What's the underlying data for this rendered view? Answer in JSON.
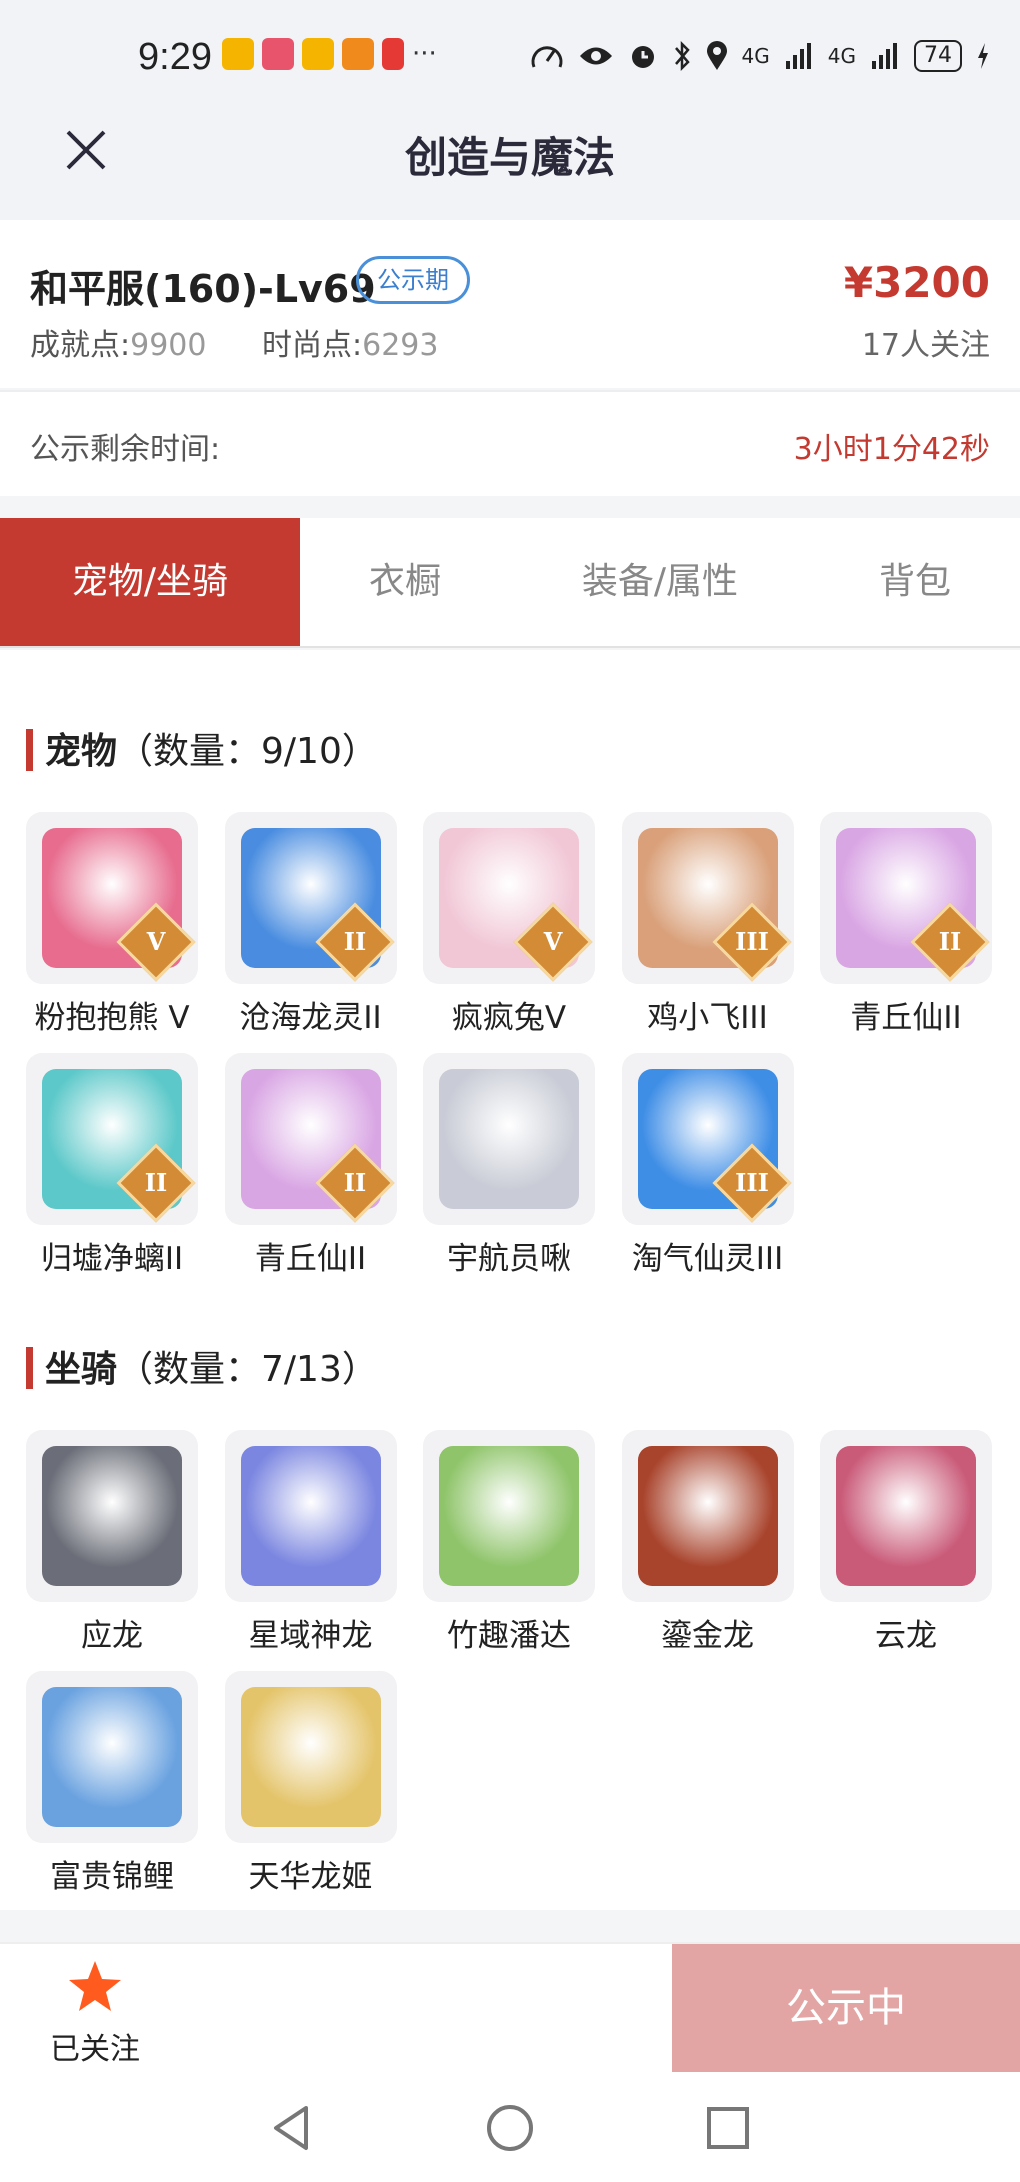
{
  "status_bar": {
    "time": "9:29",
    "network": "4G",
    "battery": "74"
  },
  "nav": {
    "title": "创造与魔法",
    "close_icon": "close-icon"
  },
  "listing": {
    "title": "和平服(160)-Lv69",
    "badge": "公示期",
    "price": "¥3200",
    "achievement_label": "成就点:",
    "achievement_value": "9900",
    "fashion_label": "时尚点:",
    "fashion_value": "6293",
    "followers": "17人关注"
  },
  "timer": {
    "label": "公示剩余时间:",
    "value": "3小时1分42秒"
  },
  "tabs": [
    {
      "label": "宠物/坐骑",
      "active": true
    },
    {
      "label": "衣橱",
      "active": false
    },
    {
      "label": "装备/属性",
      "active": false
    },
    {
      "label": "背包",
      "active": false
    }
  ],
  "pets": {
    "title": "宠物",
    "count": "（数量：9/10）",
    "items": [
      {
        "name": "粉抱抱熊 V",
        "level": "V",
        "color": "#e76c8e"
      },
      {
        "name": "沧海龙灵II",
        "level": "II",
        "color": "#4a8de0"
      },
      {
        "name": "疯疯兔V",
        "level": "V",
        "color": "#f1c7d6"
      },
      {
        "name": "鸡小飞III",
        "level": "III",
        "color": "#d9a07a"
      },
      {
        "name": "青丘仙II",
        "level": "II",
        "color": "#d9a6e4"
      },
      {
        "name": "归墟净螭II",
        "level": "II",
        "color": "#5cc8c9"
      },
      {
        "name": "青丘仙II",
        "level": "II",
        "color": "#d9a6e4"
      },
      {
        "name": "宇航员啾",
        "level": "",
        "color": "#c9ccd6"
      },
      {
        "name": "淘气仙灵III",
        "level": "III",
        "color": "#3f8ee6"
      }
    ]
  },
  "mounts": {
    "title": "坐骑",
    "count": "（数量：7/13）",
    "items": [
      {
        "name": "应龙",
        "color": "#6b6e78"
      },
      {
        "name": "星域神龙",
        "color": "#7b86e0"
      },
      {
        "name": "竹趣潘达",
        "color": "#8fc46a"
      },
      {
        "name": "鎏金龙",
        "color": "#a8432c"
      },
      {
        "name": "云龙",
        "color": "#c95a78"
      },
      {
        "name": "富贵锦鲤",
        "color": "#6aa2e0"
      },
      {
        "name": "天华龙姬",
        "color": "#e4c46a"
      }
    ]
  },
  "bottom": {
    "follow_label": "已关注",
    "status_button": "公示中",
    "star_color": "#ff5b1e"
  }
}
